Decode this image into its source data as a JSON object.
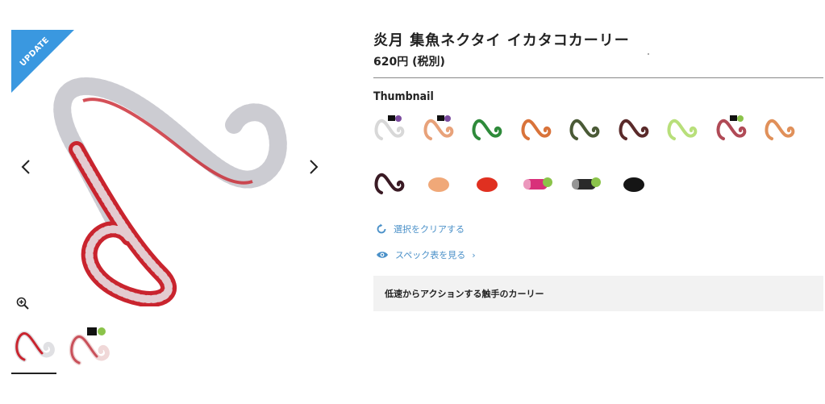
{
  "badge": {
    "label": "UPDATE",
    "color": "#3a98e0"
  },
  "product": {
    "title": "炎月 集魚ネクタイ イカタコカーリー",
    "price": "620円 (税別)"
  },
  "gallery": {
    "prev_icon": "chevron-left-icon",
    "next_icon": "chevron-right-icon",
    "zoom_icon": "zoom-in-icon",
    "thumbnails": [
      {
        "name": "thumb-1",
        "active": true
      },
      {
        "name": "thumb-2",
        "active": false
      }
    ]
  },
  "thumbnail_section": {
    "label": "Thumbnail",
    "swatches": [
      {
        "color": "#d8d8d8",
        "style": "curl",
        "badge": "black-purple"
      },
      {
        "color": "#e8a27a",
        "style": "curl",
        "badge": "black-purple"
      },
      {
        "color": "#2e8a3a",
        "style": "curl"
      },
      {
        "color": "#d9733a",
        "style": "curl"
      },
      {
        "color": "#4a5a36",
        "style": "curl"
      },
      {
        "color": "#5a2a2a",
        "style": "curl"
      },
      {
        "color": "#b8df7a",
        "style": "curl"
      },
      {
        "color": "#b04a56",
        "style": "curl",
        "badge": "black-green"
      },
      {
        "color": "#e0905a",
        "style": "curl"
      },
      {
        "color": "#3a1a24",
        "style": "curl"
      },
      {
        "color": "#f0a878",
        "style": "blob"
      },
      {
        "color": "#e03020",
        "style": "blob"
      },
      {
        "color": "#d8307a",
        "style": "bar",
        "badge": "green"
      },
      {
        "color": "#2a2a2a",
        "style": "bar",
        "badge": "green"
      },
      {
        "color": "#151515",
        "style": "blob"
      }
    ]
  },
  "actions": {
    "clear_label": "選択をクリアする",
    "clear_icon": "refresh-icon",
    "spec_label": "スペック表を見る",
    "spec_icon": "eye-icon",
    "spec_chevron": "›"
  },
  "description": "低速からアクションする触手のカーリー"
}
